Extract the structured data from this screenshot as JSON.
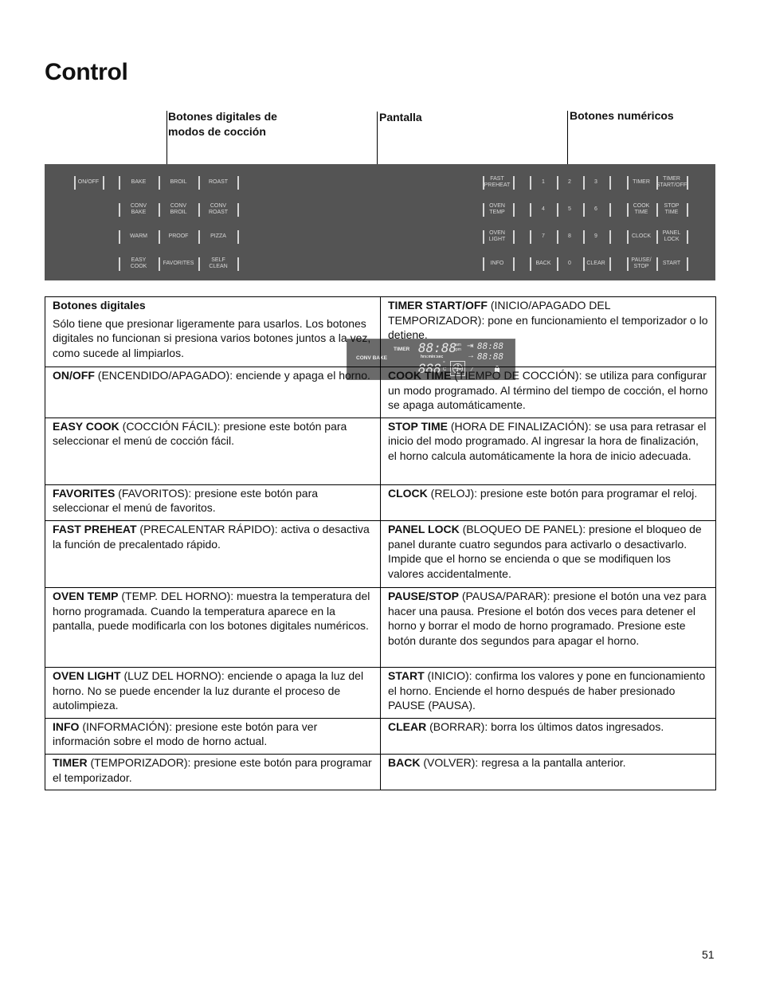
{
  "page": {
    "title": "Control",
    "page_number": "51"
  },
  "callouts": {
    "modes": "Botones digitales de\nmodos de cocción",
    "display": "Pantalla",
    "numeric": "Botones numéricos"
  },
  "panel": {
    "on_off": "ON/OFF",
    "modes": [
      [
        "BAKE",
        "BROIL",
        "ROAST"
      ],
      [
        "CONV\nBAKE",
        "CONV\nBROIL",
        "CONV\nROAST"
      ],
      [
        "WARM",
        "PROOF",
        "PIZZA"
      ],
      [
        "EASY\nCOOK",
        "FAVORITES",
        "SELF\nCLEAN"
      ]
    ],
    "left_func": [
      "FAST\nPREHEAT",
      "OVEN\nTEMP",
      "OVEN\nLIGHT",
      "INFO"
    ],
    "numbers": [
      [
        "1",
        "2",
        "3"
      ],
      [
        "4",
        "5",
        "6"
      ],
      [
        "7",
        "8",
        "9"
      ],
      [
        "BACK",
        "0",
        "CLEAR"
      ]
    ],
    "right_func": [
      [
        "TIMER",
        "TIMER\nSTART/OFF"
      ],
      [
        "COOK\nTIME",
        "STOP\nTIME"
      ],
      [
        "CLOCK",
        "PANEL\nLOCK"
      ],
      [
        "PAUSE/\nSTOP",
        "START"
      ]
    ],
    "display": {
      "mode": "CONV BAKE",
      "timer_label": "TIMER",
      "main_digits": "88:88",
      "am": "am",
      "pm": "pm",
      "units": "hrs:min:sec",
      "temp_digits": "888",
      "deg": "°",
      "c": "C",
      "cook_time_digits": "88:88",
      "stop_time_digits": "88:88",
      "icons": [
        "cook-time-arrow-icon",
        "stop-time-arrow-icon",
        "convection-fan-icon",
        "probe-icon",
        "lock-icon"
      ]
    }
  },
  "table": {
    "rows": [
      {
        "left": {
          "term": "Botones digitales",
          "heading": true,
          "desc": "Sólo tiene que presionar ligeramente para usarlos. Los botones digitales no funcionan si presiona varios botones juntos a la vez, como sucede al limpiarlos."
        },
        "right": {
          "term": "TIMER START/OFF",
          "desc": " (INICIO/APAGADO DEL TEMPORIZADOR): pone en funcionamiento el temporizador o lo detiene."
        }
      },
      {
        "left": {
          "term": "ON/OFF",
          "desc": " (ENCENDIDO/APAGADO): enciende y apaga el horno."
        },
        "right": {
          "term": "COOK TIME",
          "desc": " (TIEMPO DE COCCIÓN): se utiliza para configurar un modo programado. Al término del tiempo de cocción, el horno se apaga automáticamente."
        }
      },
      {
        "left": {
          "term": "EASY COOK",
          "desc": " (COCCIÓN FÁCIL): presione este botón para seleccionar el menú de cocción fácil."
        },
        "right": {
          "term": "STOP TIME",
          "desc": " (HORA DE FINALIZACIÓN): se usa para retrasar el inicio del modo programado. Al ingresar la hora de finalización, el horno calcula automáticamente la hora de inicio adecuada."
        }
      },
      {
        "left": {
          "term": "FAVORITES",
          "desc": " (FAVORITOS): presione este botón para seleccionar el menú de favoritos."
        },
        "right": {
          "term": "CLOCK",
          "desc": " (RELOJ): presione este botón para programar el reloj."
        }
      },
      {
        "left": {
          "term": "FAST PREHEAT",
          "desc": " (PRECALENTAR RÁPIDO): activa o desactiva la función de precalentado rápido."
        },
        "right": {
          "term": "PANEL LOCK",
          "desc": " (BLOQUEO DE PANEL): presione el bloqueo de panel durante cuatro segundos para activarlo o desactivarlo. Impide que el horno se encienda o que se modifiquen los valores accidentalmente."
        }
      },
      {
        "left": {
          "term": "OVEN TEMP",
          "desc": " (TEMP. DEL HORNO): muestra la temperatura del horno programada. Cuando la temperatura aparece en la pantalla, puede modificarla con los botones digitales numéricos."
        },
        "right": {
          "term": "PAUSE/STOP",
          "desc": " (PAUSA/PARAR): presione el botón una vez para hacer una pausa. Presione el botón dos veces para detener el horno y borrar el modo de horno programado. Presione este botón durante dos segundos para apagar el horno."
        }
      },
      {
        "left": {
          "term": "OVEN LIGHT",
          "desc": " (LUZ DEL HORNO): enciende o apaga la luz del horno. No se puede encender la luz durante el proceso de autolimpieza."
        },
        "right": {
          "term": "START",
          "desc": " (INICIO): confirma los valores y pone en funcionamiento el horno. Enciende el horno después de haber presionado PAUSE (PAUSA)."
        }
      },
      {
        "left": {
          "term": "INFO",
          "desc": " (INFORMACIÓN): presione este botón para ver información sobre el modo de horno actual."
        },
        "right": {
          "term": "CLEAR",
          "desc": " (BORRAR): borra los últimos datos ingresados."
        }
      },
      {
        "left": {
          "term": "TIMER",
          "desc": " (TEMPORIZADOR): presione este botón para programar el temporizador."
        },
        "right": {
          "term": "BACK",
          "desc": " (VOLVER): regresa a la pantalla anterior."
        }
      }
    ]
  }
}
